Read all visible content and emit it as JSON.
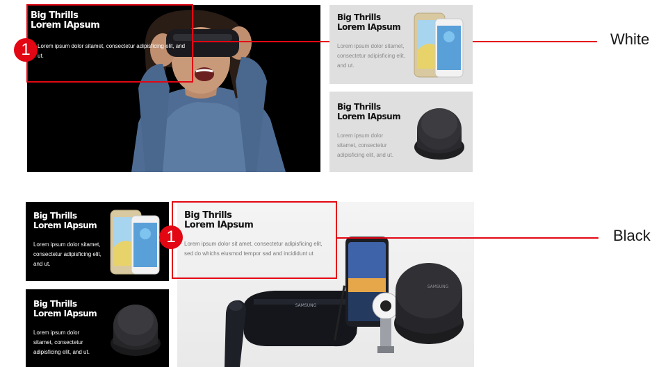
{
  "colors": {
    "highlight_red": "#e30613",
    "dark_bg": "#000000",
    "light_tile_bg": "#dfdfdf",
    "hero_light_bg": "#efefef"
  },
  "white_variant": {
    "label": "White",
    "marker": "1",
    "hero": {
      "title_line1": "Big Thrills",
      "title_line2": "Lorem IApsum",
      "description": "Lorem ipsum dolor sitamet, consectetur adipisficing elit, and ut."
    },
    "tile_phone": {
      "title_line1": "Big Thrills",
      "title_line2": "Lorem IApsum",
      "description": "Lorem ipsum dolor sitamet, consectetur adipisficing elit, and ut."
    },
    "tile_dock": {
      "title_line1": "Big Thrills",
      "title_line2": "Lorem IApsum",
      "description": "Lorem ipsum dolor sitamet, consectetur adipisficing elit, and ut."
    }
  },
  "black_variant": {
    "label": "Black",
    "marker": "1",
    "tile_phone": {
      "title_line1": "Big Thrills",
      "title_line2": "Lorem IApsum",
      "description": "Lorem ipsum dolor sitamet, consectetur adipisficing elit, and ut."
    },
    "tile_dock": {
      "title_line1": "Big Thrills",
      "title_line2": "Lorem IApsum",
      "description": "Lorem ipsum dolor sitamet, consectetur adipisficing elit, and ut."
    },
    "hero": {
      "title_line1": "Big Thrills",
      "title_line2": "Lorem IApsum",
      "description": "Lorem ipsum dolor sit amet, consectetur adipisficing elit, sed do whichs eiusmod tempor sad and incididunt ut",
      "brand_vr": "SAMSUNG",
      "brand_dock": "SAMSUNG"
    }
  },
  "icons": [
    "vr-headset-person",
    "smartphone-pair-icon",
    "dex-dock-icon",
    "vr-headset-icon",
    "vr-controller-icon",
    "galaxy-note-phone-icon",
    "gear-360-camera-icon"
  ]
}
